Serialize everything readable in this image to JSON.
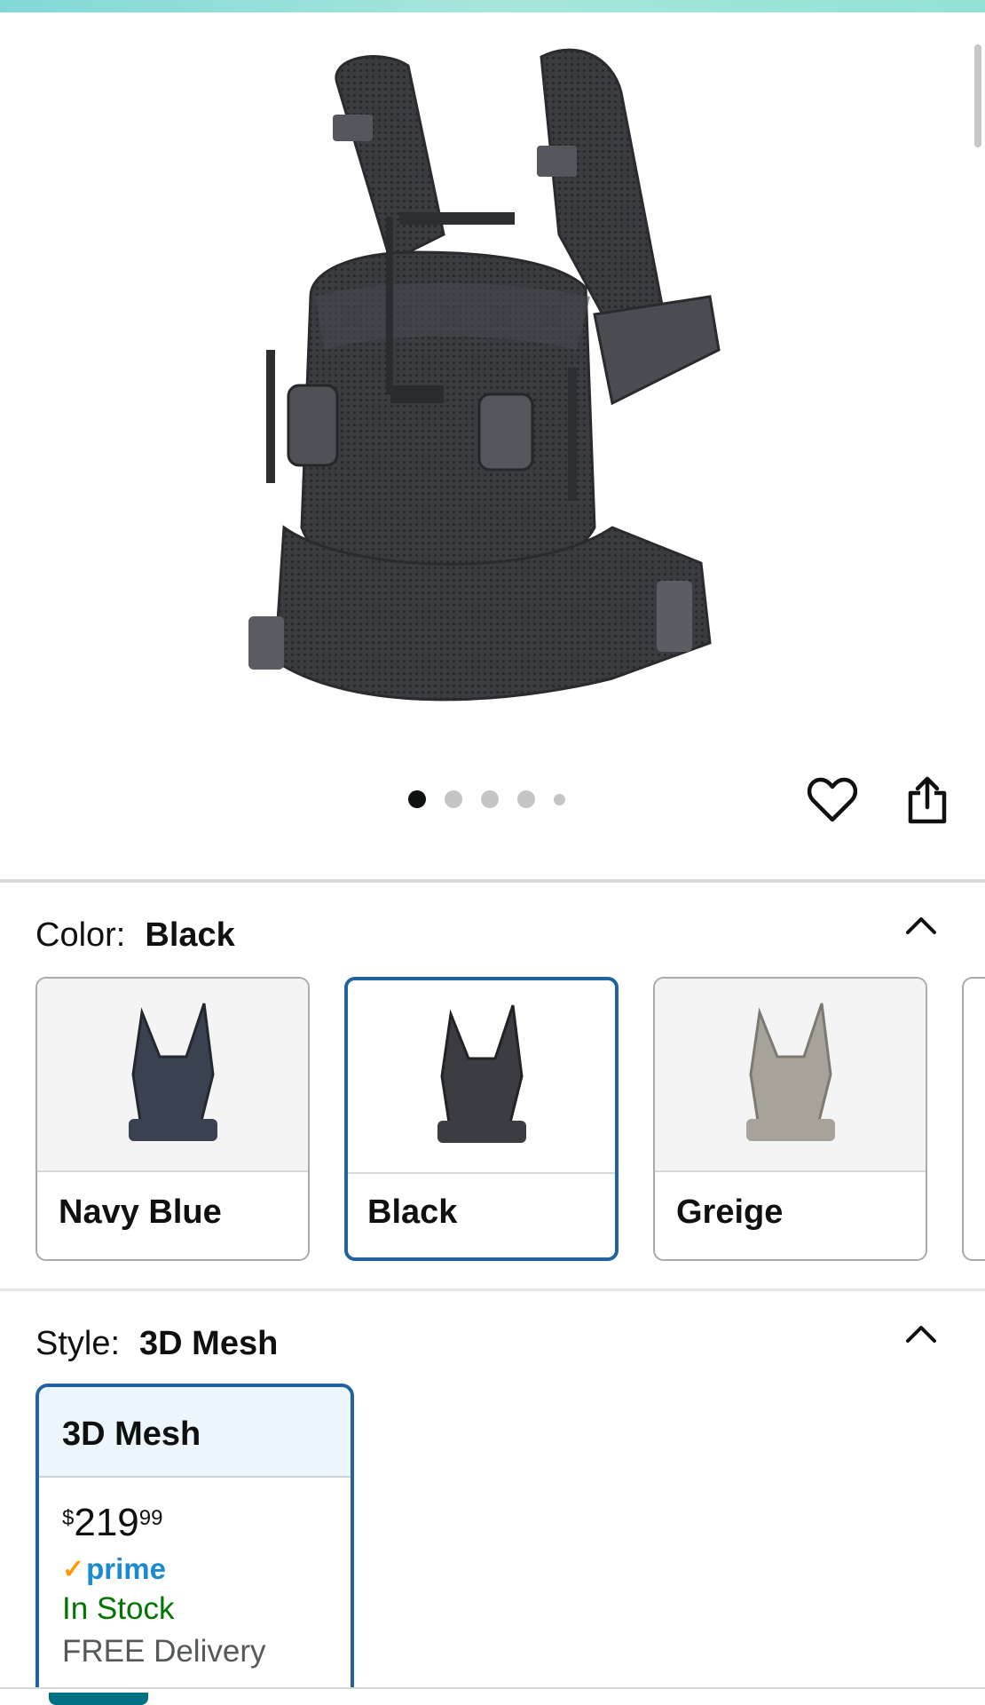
{
  "product": {
    "image_alt": "BabyBjörn baby carrier, black 3D mesh",
    "image_dots": 5,
    "active_dot": 0
  },
  "actions": {
    "wishlist_icon": "heart-icon",
    "share_icon": "share-icon"
  },
  "color": {
    "label": "Color:",
    "selected": "Black",
    "options": [
      {
        "name": "Navy Blue",
        "tone": "#3a4150"
      },
      {
        "name": "Black",
        "tone": "#3b3d42"
      },
      {
        "name": "Greige",
        "tone": "#a7a39b"
      }
    ]
  },
  "style": {
    "label": "Style:",
    "selected": "3D Mesh",
    "card": {
      "title": "3D Mesh",
      "price_symbol": "$",
      "price_whole": "219",
      "price_fraction": "99",
      "prime_label": "prime",
      "stock": "In Stock",
      "delivery": "FREE Delivery"
    }
  },
  "colors": {
    "accent": "#2162a1",
    "in_stock": "#007600",
    "prime_blue": "#1a8bd0",
    "prime_check": "#ff9900"
  }
}
